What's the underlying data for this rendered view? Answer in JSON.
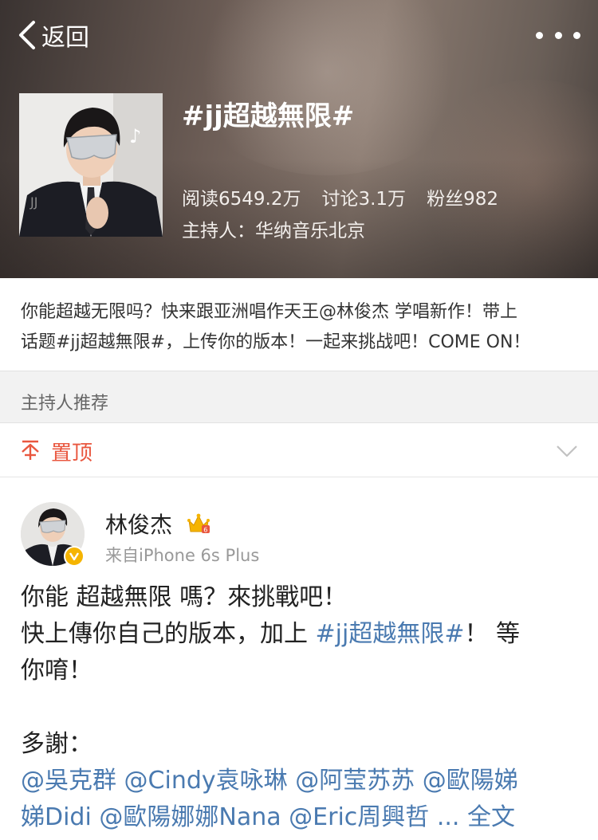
{
  "nav": {
    "back_label": "返回"
  },
  "topic": {
    "title": "#jj超越無限#",
    "stats": {
      "reads": "阅读6549.2万",
      "discussions": "讨论3.1万",
      "fans": "粉丝982"
    },
    "host": "主持人：华纳音乐北京"
  },
  "description": {
    "line1": "你能超越无限吗？快来跟亚洲唱作天王@林俊杰 学唱新作！带上",
    "line2": "话题#jj超越無限#，上传你的版本！一起来挑战吧！COME ON！"
  },
  "section": {
    "title": "主持人推荐"
  },
  "pinned": {
    "label": "置顶"
  },
  "post": {
    "author": "林俊杰",
    "source": "来自iPhone 6s Plus",
    "line1": "你能 超越無限 嗎？來挑戰吧！",
    "line2_pre": "快上傳你自己的版本，加上 ",
    "line2_tag": "#jj超越無限#",
    "line2_post": "！ 等",
    "line3": "你唷！",
    "thanks": "多謝：",
    "mentions_line1": [
      "@吳克群",
      "@Cindy袁咏琳",
      "@阿莹苏苏",
      "@歐陽娣"
    ],
    "mentions_line2": [
      "娣Didi",
      "@歐陽娜娜Nana",
      "@Eric周興哲"
    ],
    "more_label": "... 全文"
  },
  "colors": {
    "link": "#4a7ab0",
    "pinned": "#e9573f",
    "verified": "#f5b400"
  },
  "icons": [
    "chevron-left-icon",
    "more-dots-icon",
    "pin-top-icon",
    "chevron-down-icon",
    "crown-icon",
    "verified-icon"
  ]
}
